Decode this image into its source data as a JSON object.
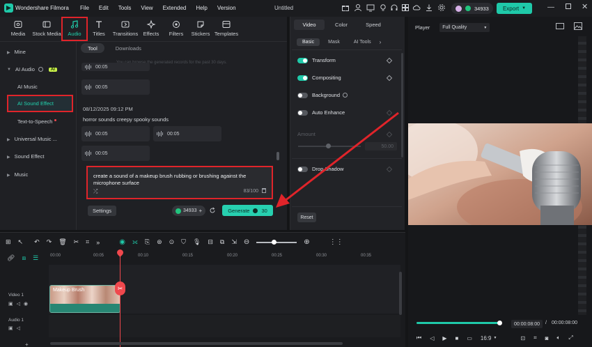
{
  "app": {
    "name": "Wondershare Filmora",
    "menu": [
      "File",
      "Edit",
      "Tools",
      "View",
      "Extended",
      "Help",
      "Version"
    ],
    "document_title": "Untitled",
    "credits": "34933",
    "export_label": "Export"
  },
  "top_tabs": [
    {
      "label": "Media",
      "icon": "media-icon"
    },
    {
      "label": "Stock Media",
      "icon": "stock-media-icon"
    },
    {
      "label": "Audio",
      "icon": "music-note-icon"
    },
    {
      "label": "Titles",
      "icon": "titles-icon"
    },
    {
      "label": "Transitions",
      "icon": "transitions-icon"
    },
    {
      "label": "Effects",
      "icon": "effects-icon"
    },
    {
      "label": "Filters",
      "icon": "filters-icon"
    },
    {
      "label": "Stickers",
      "icon": "stickers-icon"
    },
    {
      "label": "Templates",
      "icon": "templates-icon"
    }
  ],
  "sidebar": {
    "mine": "Mine",
    "ai_audio": "AI Audio",
    "ai_badge": "AI",
    "ai_music": "AI Music",
    "ai_sound_effect": "AI Sound Effect",
    "text_to_speech": "Text-to-Speech",
    "universal_music": "Universal Music ...",
    "sound_effect": "Sound Effect",
    "music": "Music"
  },
  "subtabs": {
    "tool": "Tool",
    "downloads": "Downloads",
    "hint": "You can browse the generated records for the past 30 days."
  },
  "records": {
    "chip_time": "00:05",
    "date": "08/12/2025 09:12 PM",
    "prompt": "horror sounds creepy spooky sounds"
  },
  "prompt_input": {
    "value": "create a sound of a makeup brush rubbing or brushing against the microphone surface",
    "count": "83/100"
  },
  "actions": {
    "settings": "Settings",
    "credits": "34933",
    "generate": "Generate",
    "generate_cost": "30"
  },
  "properties": {
    "tabs": [
      "Video",
      "Color",
      "Speed"
    ],
    "subtabs": [
      "Basic",
      "Mask",
      "AI Tools"
    ],
    "transform": "Transform",
    "compositing": "Compositing",
    "background": "Background",
    "auto_enhance": "Auto Enhance",
    "amount": "Amount",
    "amount_value": "50.00",
    "drop_shadow": "Drop Shadow",
    "reset": "Reset"
  },
  "player": {
    "label": "Player",
    "quality": "Full Quality",
    "current_time": "00:00:08:00",
    "separator": "/",
    "total_time": "00:00:08:00",
    "aspect": "16:9",
    "progress": 0.98
  },
  "timeline": {
    "ticks": [
      "00:00",
      "00:05",
      "00:10",
      "00:15",
      "00:20",
      "00:25",
      "00:30",
      "00:35"
    ],
    "video_track": "Video 1",
    "audio_track": "Audio 1",
    "clip_title": "Makeup Brush"
  },
  "colors": {
    "accent": "#1fc9a9",
    "highlight": "#e0242a",
    "playhead": "#f0484d"
  }
}
